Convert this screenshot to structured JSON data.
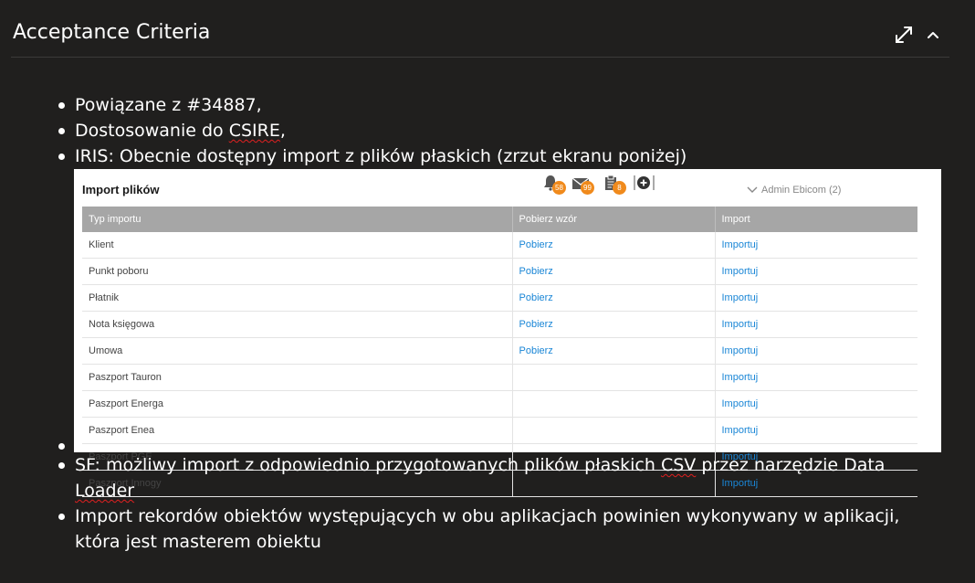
{
  "header": {
    "title": "Acceptance Criteria",
    "expand_icon": "expand-icon",
    "collapse_icon": "chevron-up-icon"
  },
  "items": {
    "i1": {
      "text": "Powiązane z #34887,"
    },
    "i2": {
      "pre": "Dostosowanie do ",
      "flag": "CSIRE",
      "post": ","
    },
    "i3": {
      "text": "IRIS: Obecnie dostępny import z plików płaskich (zrzut ekranu poniżej)"
    },
    "i5": {
      "pre": "SF: możliwy import z odpowiednio przygotowanych plików płaskich ",
      "flag1": "CSV",
      "mid": " przez narzędzie Data ",
      "flag2": "Loader"
    },
    "i6": {
      "text": "Import rekordów obiektów występujących w obu aplikacjach powinien wykonywany w aplikacji, która jest masterem obiektu"
    }
  },
  "screenshot": {
    "title": "Import plików",
    "badges": {
      "notifications": "58",
      "messages": "99",
      "tasks": "8"
    },
    "user": "Admin Ebicom (2)",
    "columns": [
      "Typ importu",
      "Pobierz wzór",
      "Import"
    ],
    "rows": [
      {
        "type": "Klient",
        "download": "Pobierz",
        "import": "Importuj"
      },
      {
        "type": "Punkt poboru",
        "download": "Pobierz",
        "import": "Importuj"
      },
      {
        "type": "Płatnik",
        "download": "Pobierz",
        "import": "Importuj"
      },
      {
        "type": "Nota księgowa",
        "download": "Pobierz",
        "import": "Importuj"
      },
      {
        "type": "Umowa",
        "download": "Pobierz",
        "import": "Importuj"
      },
      {
        "type": "Paszport Tauron",
        "download": "",
        "import": "Importuj"
      },
      {
        "type": "Paszport Energa",
        "download": "",
        "import": "Importuj"
      },
      {
        "type": "Paszport Enea",
        "download": "",
        "import": "Importuj"
      },
      {
        "type": "Paszport PGE",
        "download": "",
        "import": "Importuj"
      },
      {
        "type": "Paszport Innogy",
        "download": "",
        "import": "Importuj"
      }
    ]
  },
  "colors": {
    "background": "#201f1e",
    "link": "#1a86d6",
    "badge": "#f08a1c",
    "header_row": "#a6a6a6"
  }
}
